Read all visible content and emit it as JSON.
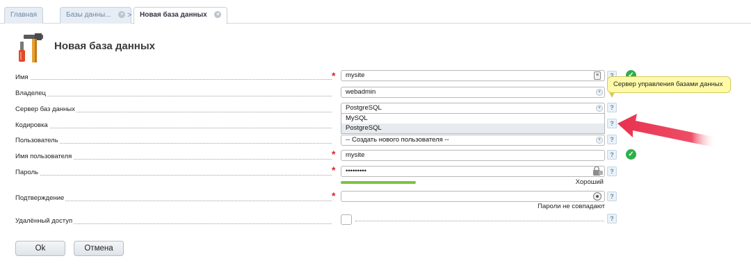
{
  "tabs": [
    {
      "label": "Главная"
    },
    {
      "label": "Базы данны..."
    },
    {
      "label": "Новая база данных"
    }
  ],
  "page": {
    "title": "Новая база данных"
  },
  "form": {
    "name": {
      "label": "Имя",
      "value": "mysite"
    },
    "owner": {
      "label": "Владелец",
      "value": "webadmin"
    },
    "db_server": {
      "label": "Сервер баз данных",
      "value": "PostgreSQL",
      "options": [
        "MySQL",
        "PostgreSQL"
      ],
      "tooltip": "Сервер управления базами данных"
    },
    "encoding": {
      "label": "Кодировка"
    },
    "user": {
      "label": "Пользователь",
      "value": "-- Создать нового пользователя --"
    },
    "username": {
      "label": "Имя пользователя",
      "value": "mysite"
    },
    "password": {
      "label": "Пароль",
      "value": "•••••••••",
      "strength": "Хороший",
      "strength_fraction": 0.28
    },
    "confirm": {
      "label": "Подтверждение",
      "value": "",
      "status": "Пароли не совпадают"
    },
    "remote_access": {
      "label": "Удалённый доступ",
      "checked": false
    }
  },
  "buttons": {
    "ok": "Ok",
    "cancel": "Отмена"
  },
  "colors": {
    "accent_valid": "#2eaf4a",
    "required": "#dd2222",
    "strength": "#7cc242",
    "annotation_arrow": "#e8314f",
    "tooltip_bg": "#fffaa8"
  }
}
